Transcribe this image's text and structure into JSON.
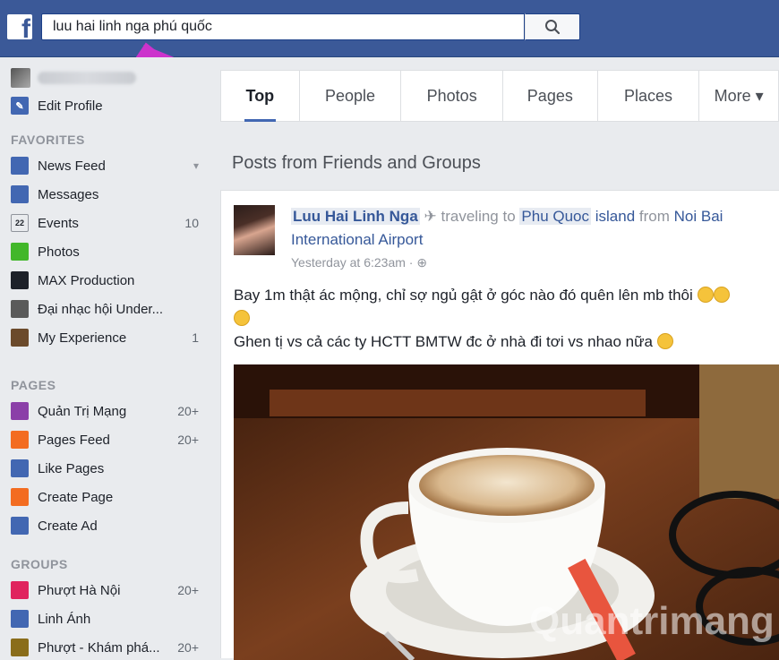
{
  "header": {
    "logo": "f",
    "search_value": "luu hai linh nga phú quốc",
    "search_icon": "search-icon"
  },
  "sidebar": {
    "edit_profile": "Edit Profile",
    "favorites_heading": "FAVORITES",
    "favorites": [
      {
        "label": "News Feed",
        "count": "",
        "icon": "news-feed-icon",
        "color": "#4267b2"
      },
      {
        "label": "Messages",
        "count": "",
        "icon": "messages-icon",
        "color": "#4267b2"
      },
      {
        "label": "Events",
        "count": "10",
        "icon": "calendar-icon",
        "color": "#e9ebee"
      },
      {
        "label": "Photos",
        "count": "",
        "icon": "photos-icon",
        "color": "#42b72a"
      },
      {
        "label": "MAX Production",
        "count": "",
        "icon": "page-icon",
        "color": "#1d2129"
      },
      {
        "label": "Đại nhạc hội Under...",
        "count": "",
        "icon": "group-icon",
        "color": "#5a5a5a"
      },
      {
        "label": "My Experience",
        "count": "1",
        "icon": "group-icon",
        "color": "#6b4a2b"
      }
    ],
    "pages_heading": "PAGES",
    "pages": [
      {
        "label": "Quản Trị Mạng",
        "count": "20+",
        "icon": "page-logo-icon",
        "color": "#8b3fa8"
      },
      {
        "label": "Pages Feed",
        "count": "20+",
        "icon": "flag-icon",
        "color": "#f36c21"
      },
      {
        "label": "Like Pages",
        "count": "",
        "icon": "thumbs-up-icon",
        "color": "#4267b2"
      },
      {
        "label": "Create Page",
        "count": "",
        "icon": "plus-icon",
        "color": "#f36c21"
      },
      {
        "label": "Create Ad",
        "count": "",
        "icon": "chart-icon",
        "color": "#4267b2"
      }
    ],
    "groups_heading": "GROUPS",
    "groups": [
      {
        "label": "Phượt Hà Nội",
        "count": "20+",
        "icon": "heart-icon",
        "color": "#e0245e"
      },
      {
        "label": "Linh Ánh",
        "count": "",
        "icon": "group-icon",
        "color": "#4267b2"
      },
      {
        "label": "Phượt - Khám phá...",
        "count": "20+",
        "icon": "trophy-icon",
        "color": "#8a6d1b"
      }
    ]
  },
  "tabs": [
    {
      "label": "Top",
      "active": true
    },
    {
      "label": "People",
      "active": false
    },
    {
      "label": "Photos",
      "active": false
    },
    {
      "label": "Pages",
      "active": false
    },
    {
      "label": "Places",
      "active": false
    },
    {
      "label": "More ▾",
      "active": false
    }
  ],
  "section_title": "Posts from Friends and Groups",
  "post": {
    "author": "Luu Hai Linh Nga",
    "activity": "traveling to",
    "place": "Phu Quoc",
    "place_suffix": "island",
    "from": "from",
    "origin": "Noi Bai International Airport",
    "time": "Yesterday at 6:23am ·",
    "text_line1": "Bay 1m thật ác mộng, chỉ sợ ngủ gật ở góc nào đó quên lên mb thôi",
    "text_line2": "Ghen tị vs cả các ty HCTT BMTW đc ở nhà đi tơi vs nhao nữa"
  },
  "watermark": "uantrimang",
  "colors": {
    "brand": "#3b5998",
    "link": "#365899",
    "annotation_arrow": "#cc33cc"
  }
}
